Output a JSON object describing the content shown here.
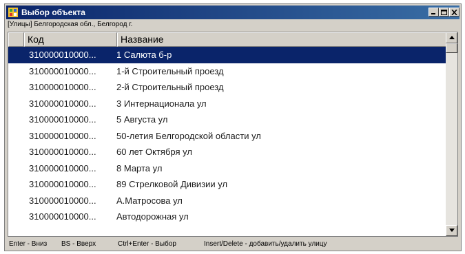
{
  "window": {
    "title": "Выбор объекта"
  },
  "breadcrumb": "[Улицы] Белгородская обл., Белгород г.",
  "table": {
    "columns": [
      "Код",
      "Название"
    ],
    "rows": [
      {
        "code": "310000010000...",
        "name": "1 Салюта б-р",
        "selected": true
      },
      {
        "code": "310000010000...",
        "name": "1-й Строительный проезд"
      },
      {
        "code": "310000010000...",
        "name": "2-й Строительный проезд"
      },
      {
        "code": "310000010000...",
        "name": "3 Интернационала ул"
      },
      {
        "code": "310000010000...",
        "name": "5 Августа ул"
      },
      {
        "code": "310000010000...",
        "name": "50-летия Белгородской области ул"
      },
      {
        "code": "310000010000...",
        "name": "60 лет Октября ул"
      },
      {
        "code": "310000010000...",
        "name": "8 Марта ул"
      },
      {
        "code": "310000010000...",
        "name": "89 Стрелковой Дивизии ул"
      },
      {
        "code": "310000010000...",
        "name": "А.Матросова ул"
      },
      {
        "code": "310000010000...",
        "name": "Автодорожная ул"
      }
    ]
  },
  "status": {
    "hints": [
      "Enter - Вниз",
      "BS - Вверх",
      "Ctrl+Enter - Выбор",
      "Insert/Delete - добавить/удалить улицу"
    ]
  },
  "colors": {
    "titlebar": "#0a246a",
    "selection": "#0a246a",
    "chrome": "#d4d0c8"
  },
  "icons": [
    "app-icon",
    "minimize-icon",
    "maximize-icon",
    "close-icon",
    "scroll-up-icon",
    "scroll-down-icon"
  ]
}
